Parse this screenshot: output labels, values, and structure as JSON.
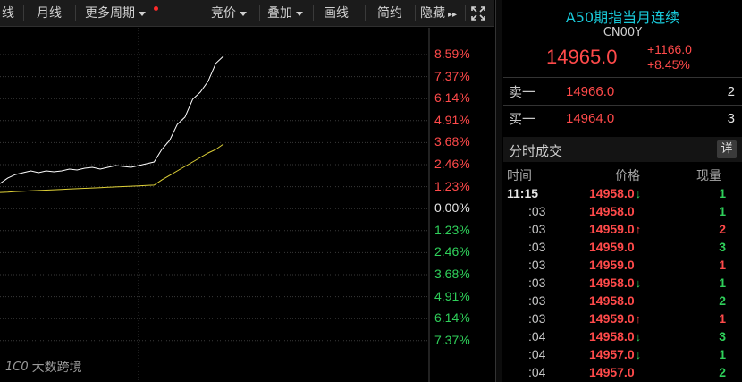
{
  "toolbar": {
    "items": [
      {
        "label": "线",
        "dropdown": false
      },
      {
        "label": "月线",
        "dropdown": false
      },
      {
        "label": "更多周期",
        "dropdown": true
      },
      {
        "label": "竞价",
        "dropdown": true
      },
      {
        "label": "叠加",
        "dropdown": true
      },
      {
        "label": "画线",
        "dropdown": false
      },
      {
        "label": "简约",
        "dropdown": false
      },
      {
        "label": "隐藏",
        "dropdown": false
      }
    ],
    "hide_arrow": "▸▸"
  },
  "chart_data": {
    "type": "line",
    "y_axis_labels": [
      {
        "text": "8.59%",
        "color": "#ff4a4a"
      },
      {
        "text": "7.37%",
        "color": "#ff4a4a"
      },
      {
        "text": "6.14%",
        "color": "#ff4a4a"
      },
      {
        "text": "4.91%",
        "color": "#ff4a4a"
      },
      {
        "text": "3.68%",
        "color": "#ff4a4a"
      },
      {
        "text": "2.46%",
        "color": "#ff4a4a"
      },
      {
        "text": "1.23%",
        "color": "#ff4a4a"
      },
      {
        "text": "0.00%",
        "color": "#e6e6e6"
      },
      {
        "text": "1.23%",
        "color": "#2fd05a"
      },
      {
        "text": "2.46%",
        "color": "#2fd05a"
      },
      {
        "text": "3.68%",
        "color": "#2fd05a"
      },
      {
        "text": "4.91%",
        "color": "#2fd05a"
      },
      {
        "text": "6.14%",
        "color": "#2fd05a"
      },
      {
        "text": "7.37%",
        "color": "#2fd05a"
      }
    ],
    "ylim": [
      -7.37,
      8.59
    ],
    "series": [
      {
        "color": "#ffffff",
        "values": [
          1.4,
          1.7,
          1.9,
          2.0,
          2.1,
          2.0,
          2.1,
          2.05,
          2.1,
          2.2,
          2.15,
          2.25,
          2.3,
          2.2,
          2.3,
          2.4,
          2.35,
          2.3,
          2.4,
          2.5,
          2.6,
          3.3,
          4.0,
          4.6,
          5.2,
          5.9,
          6.5,
          7.3,
          8.0,
          8.6
        ]
      },
      {
        "color": "#e0d238",
        "values": [
          0.9,
          0.92,
          0.95,
          0.97,
          0.99,
          1.01,
          1.03,
          1.05,
          1.07,
          1.09,
          1.11,
          1.13,
          1.15,
          1.17,
          1.19,
          1.21,
          1.23,
          1.25,
          1.27,
          1.29,
          1.31,
          1.6,
          1.85,
          2.1,
          2.35,
          2.6,
          2.85,
          3.1,
          3.3,
          3.6
        ]
      }
    ],
    "grid": true
  },
  "colors": {
    "up": "#ff4a4a",
    "down": "#2fd05a",
    "title": "#19c8d8"
  },
  "watermark": {
    "logo_text": "1C0",
    "text": "大数跨境"
  },
  "panel": {
    "title": "A50期指当月连续",
    "code": "CN00Y",
    "price": "14965.0",
    "change_abs": "+1166.0",
    "change_pct": "+8.45%",
    "orderbook": [
      {
        "label": "卖一",
        "price": "14966.0",
        "volume": "2"
      },
      {
        "label": "买一",
        "price": "14964.0",
        "volume": "3"
      }
    ],
    "ticks_title": "分时成交",
    "detail_label": "详",
    "columns": {
      "time": "时间",
      "price": "价格",
      "volume": "现量"
    },
    "ticks": [
      {
        "time": "11:15",
        "price": "14958.0",
        "arrow": "↓",
        "arrow_color": "#2fd05a",
        "volume": "1",
        "vol_color": "#2fd05a",
        "full": true
      },
      {
        "time": ":03",
        "price": "14958.0",
        "arrow": "",
        "arrow_color": "",
        "volume": "1",
        "vol_color": "#2fd05a",
        "full": false
      },
      {
        "time": ":03",
        "price": "14959.0",
        "arrow": "↑",
        "arrow_color": "#ff4a4a",
        "volume": "2",
        "vol_color": "#ff4a4a",
        "full": false
      },
      {
        "time": ":03",
        "price": "14959.0",
        "arrow": "",
        "arrow_color": "",
        "volume": "3",
        "vol_color": "#2fd05a",
        "full": false
      },
      {
        "time": ":03",
        "price": "14959.0",
        "arrow": "",
        "arrow_color": "",
        "volume": "1",
        "vol_color": "#ff4a4a",
        "full": false
      },
      {
        "time": ":03",
        "price": "14958.0",
        "arrow": "↓",
        "arrow_color": "#2fd05a",
        "volume": "1",
        "vol_color": "#2fd05a",
        "full": false
      },
      {
        "time": ":03",
        "price": "14958.0",
        "arrow": "",
        "arrow_color": "",
        "volume": "2",
        "vol_color": "#2fd05a",
        "full": false
      },
      {
        "time": ":03",
        "price": "14959.0",
        "arrow": "↑",
        "arrow_color": "#ff4a4a",
        "volume": "1",
        "vol_color": "#ff4a4a",
        "full": false
      },
      {
        "time": ":04",
        "price": "14958.0",
        "arrow": "↓",
        "arrow_color": "#2fd05a",
        "volume": "3",
        "vol_color": "#2fd05a",
        "full": false
      },
      {
        "time": ":04",
        "price": "14957.0",
        "arrow": "↓",
        "arrow_color": "#2fd05a",
        "volume": "1",
        "vol_color": "#2fd05a",
        "full": false
      },
      {
        "time": ":04",
        "price": "14957.0",
        "arrow": "",
        "arrow_color": "",
        "volume": "2",
        "vol_color": "#2fd05a",
        "full": false
      }
    ]
  }
}
